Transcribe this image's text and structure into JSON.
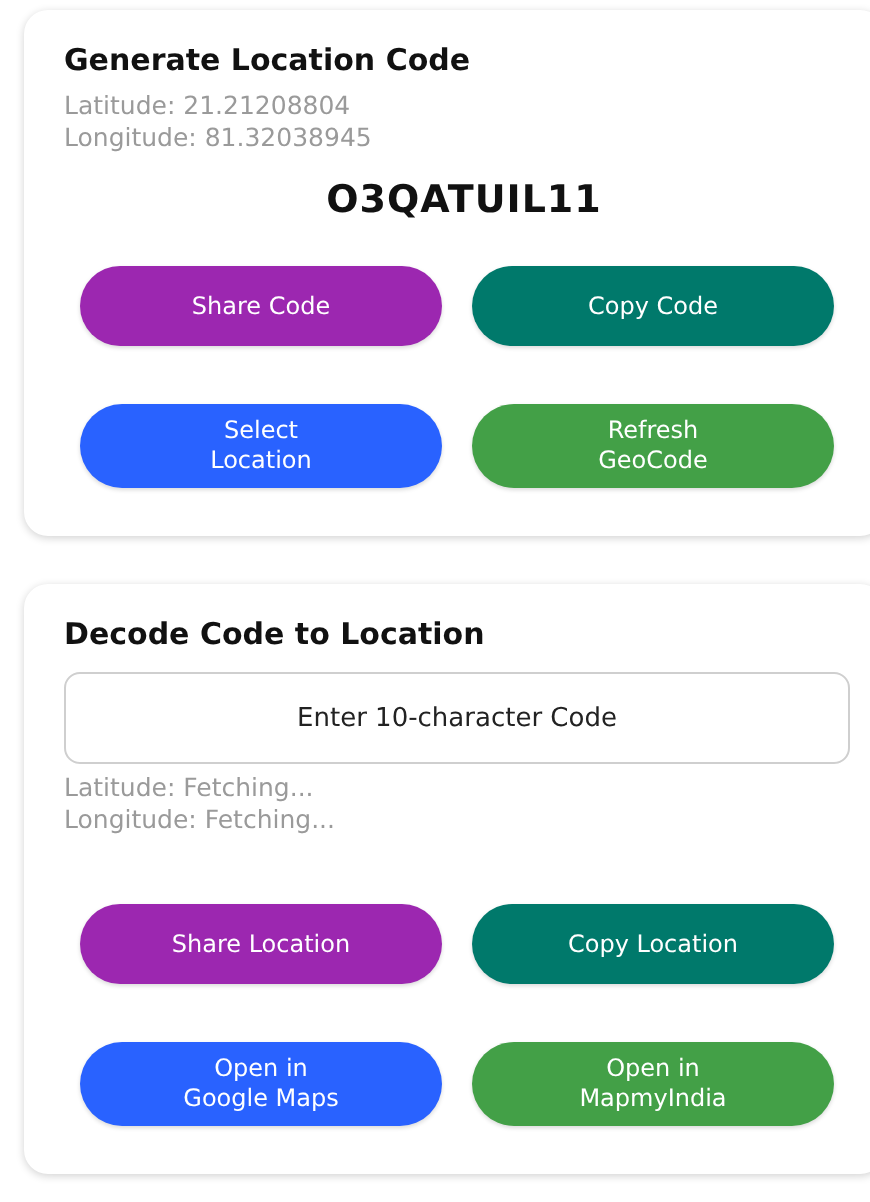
{
  "generate": {
    "title": "Generate Location Code",
    "latitude": "Latitude: 21.21208804",
    "longitude": "Longitude: 81.32038945",
    "code": "O3QATUIL11",
    "buttons": [
      {
        "label": "Share Code",
        "color": "#9c27b0"
      },
      {
        "label": "Copy Code",
        "color": "#00796b"
      },
      {
        "label": "Select\nLocation",
        "color": "#2962ff"
      },
      {
        "label": "Refresh\nGeoCode",
        "color": "#43a047"
      }
    ]
  },
  "decode": {
    "title": "Decode Code to Location",
    "input": {
      "placeholder": "Enter 10-character Code"
    },
    "latitude": "Latitude: Fetching...",
    "longitude": "Longitude: Fetching...",
    "buttons": [
      {
        "label": "Share Location",
        "color": "#9c27b0"
      },
      {
        "label": "Copy Location",
        "color": "#00796b"
      },
      {
        "label": "Open in\nGoogle Maps",
        "color": "#2962ff"
      },
      {
        "label": "Open in\nMapmyIndia",
        "color": "#43a047"
      }
    ]
  }
}
